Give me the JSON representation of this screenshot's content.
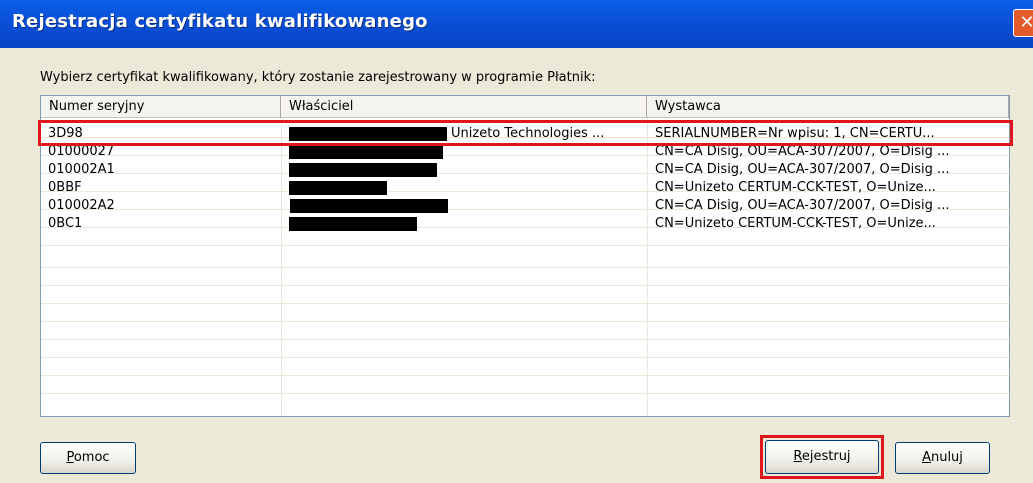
{
  "window": {
    "title": "Rejestracja certyfikatu kwalifikowanego",
    "close_label": "✕"
  },
  "instruction": "Wybierz certyfikat kwalifikowany, który zostanie zarejestrowany w programie Płatnik:",
  "table": {
    "columns": [
      "Numer seryjny",
      "Właściciel",
      "Wystawca"
    ],
    "rows": [
      {
        "serial": "3D98",
        "owner": "Unizeto Technologies ...",
        "issuer": "SERIALNUMBER=Nr wpisu: 1, CN=CERTU...",
        "selected": true
      },
      {
        "serial": "01000027",
        "owner": "",
        "issuer": "CN=CA Disig, OU=ACA-307/2007, O=Disig ..."
      },
      {
        "serial": "010002A1",
        "owner": "",
        "issuer": "CN=CA Disig, OU=ACA-307/2007, O=Disig ..."
      },
      {
        "serial": "0BBF",
        "owner": "",
        "issuer": "CN=Unizeto CERTUM-CCK-TEST, O=Unize..."
      },
      {
        "serial": "010002A2",
        "owner": "",
        "issuer": "CN=CA Disig, OU=ACA-307/2007, O=Disig ..."
      },
      {
        "serial": "0BC1",
        "owner": "",
        "issuer": "CN=Unizeto CERTUM-CCK-TEST, O=Unize..."
      }
    ]
  },
  "buttons": {
    "help": {
      "label_prefix": "",
      "accel": "P",
      "label_rest": "omoc"
    },
    "register": {
      "label_prefix": "",
      "accel": "R",
      "label_rest": "ejestruj"
    },
    "cancel": {
      "label_prefix": "",
      "accel": "A",
      "label_rest": "nuluj"
    }
  },
  "colors": {
    "titlebar": "#0b4fd8",
    "highlight": "#e0161e",
    "dialog_bg": "#ece9d8"
  }
}
